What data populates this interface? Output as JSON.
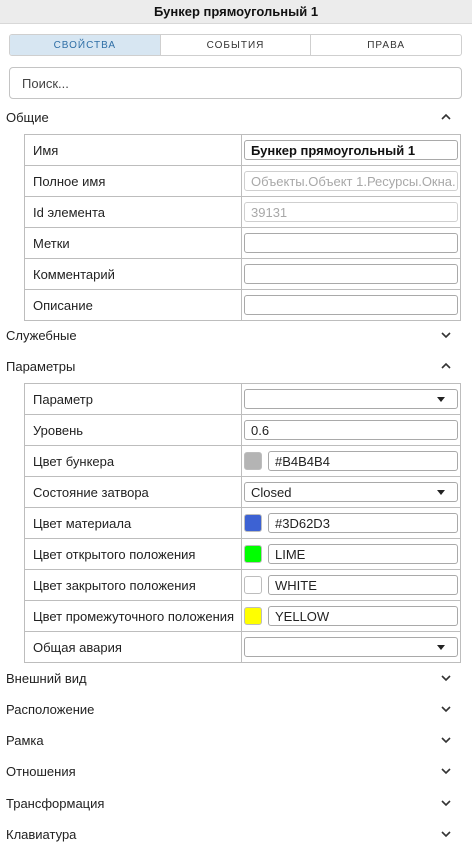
{
  "window": {
    "title": "Бункер прямоугольный 1"
  },
  "tabs": [
    {
      "label": "СВОЙСТВА",
      "active": true
    },
    {
      "label": "СОБЫТИЯ",
      "active": false
    },
    {
      "label": "ПРАВА",
      "active": false
    }
  ],
  "search": {
    "placeholder": "Поиск..."
  },
  "sections": {
    "general": {
      "title": "Общие",
      "expanded": true,
      "rows": {
        "name": {
          "label": "Имя",
          "value": "Бункер прямоугольный 1"
        },
        "full_name": {
          "label": "Полное имя",
          "value": "Объекты.Объект 1.Ресурсы.Окна."
        },
        "element_id": {
          "label": "Id элемента",
          "value": "39131"
        },
        "tags": {
          "label": "Метки",
          "value": ""
        },
        "comment": {
          "label": "Комментарий",
          "value": ""
        },
        "description": {
          "label": "Описание",
          "value": ""
        }
      }
    },
    "service": {
      "title": "Служебные",
      "expanded": false
    },
    "params": {
      "title": "Параметры",
      "expanded": true,
      "rows": {
        "parameter": {
          "label": "Параметр",
          "value": ""
        },
        "level": {
          "label": "Уровень",
          "value": "0.6"
        },
        "bunker_color": {
          "label": "Цвет бункера",
          "value": "#B4B4B4",
          "swatch": "#B4B4B4"
        },
        "gate_state": {
          "label": "Состояние затвора",
          "value": "Closed"
        },
        "material_color": {
          "label": "Цвет материала",
          "value": "#3D62D3",
          "swatch": "#3D62D3"
        },
        "open_color": {
          "label": "Цвет открытого положения",
          "value": "LIME",
          "swatch": "#00FF00"
        },
        "closed_color": {
          "label": "Цвет закрытого положения",
          "value": "WHITE",
          "swatch": "#FFFFFF"
        },
        "mid_color": {
          "label": "Цвет промежуточного положения",
          "value": "YELLOW",
          "swatch": "#FFFF00"
        },
        "alarm": {
          "label": "Общая авария",
          "value": ""
        }
      }
    },
    "appearance": {
      "title": "Внешний вид",
      "expanded": false
    },
    "location": {
      "title": "Расположение",
      "expanded": false
    },
    "frame": {
      "title": "Рамка",
      "expanded": false
    },
    "relations": {
      "title": "Отношения",
      "expanded": false
    },
    "transform": {
      "title": "Трансформация",
      "expanded": false
    },
    "keyboard": {
      "title": "Клавиатура",
      "expanded": false
    }
  },
  "icons": {
    "expanded": "chevron-up-icon",
    "collapsed": "chevron-down-icon",
    "dropdown": "dropdown-caret-icon"
  },
  "colors": {
    "header_bg": "#ECECEC",
    "active_tab_bg": "#D7E6F2",
    "active_tab_text": "#2F6FA6"
  }
}
